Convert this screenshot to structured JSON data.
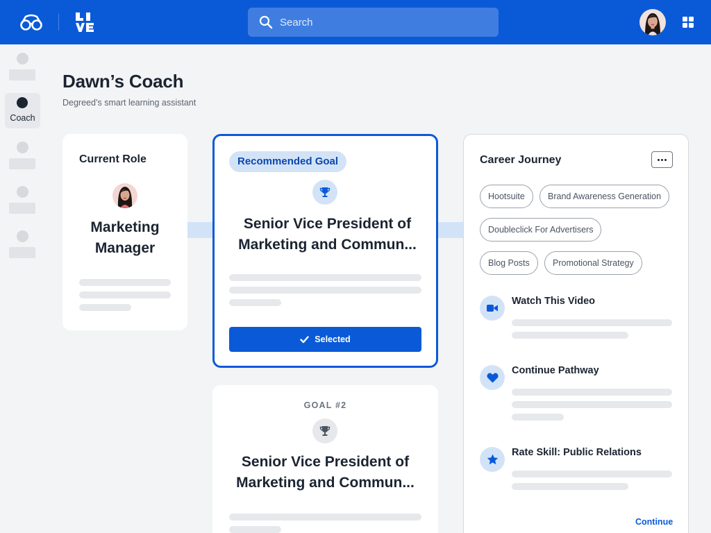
{
  "header": {
    "search_placeholder": "Search"
  },
  "icons": {
    "logo": "glasses-logo-icon",
    "brand": "brand-logo-icon",
    "search": "search-icon",
    "apps": "apps-grid-icon"
  },
  "colors": {
    "topbar": "#0a5ad8",
    "accent_light": "#d3e3f7",
    "text_dark": "#1b2431"
  },
  "sidebar": {
    "active_label": "Coach"
  },
  "page": {
    "title": "Dawn’s Coach",
    "subtitle": "Degreed’s smart learning assistant"
  },
  "current_role": {
    "heading": "Current Role",
    "role": "Marketing Manager"
  },
  "recommended_goal": {
    "badge": "Recommended Goal",
    "title_line1": "Senior Vice President of",
    "title_line2": "Marketing and Commun...",
    "button_label": "Selected"
  },
  "goal2": {
    "label": "GOAL #2",
    "title_line1": "Senior Vice President of",
    "title_line2": "Marketing and Commun..."
  },
  "career_journey": {
    "title": "Career Journey",
    "tags": [
      "Hootsuite",
      "Brand Awareness Generation",
      "Doubleclick For Advertisers",
      "Blog Posts",
      "Promotional Strategy"
    ],
    "activities": [
      {
        "title": "Watch This Video",
        "icon": "video-camera-icon"
      },
      {
        "title": "Continue Pathway",
        "icon": "heart-icon"
      },
      {
        "title": "Rate Skill: Public Relations",
        "icon": "star-icon"
      }
    ],
    "continue_label": "Continue"
  }
}
